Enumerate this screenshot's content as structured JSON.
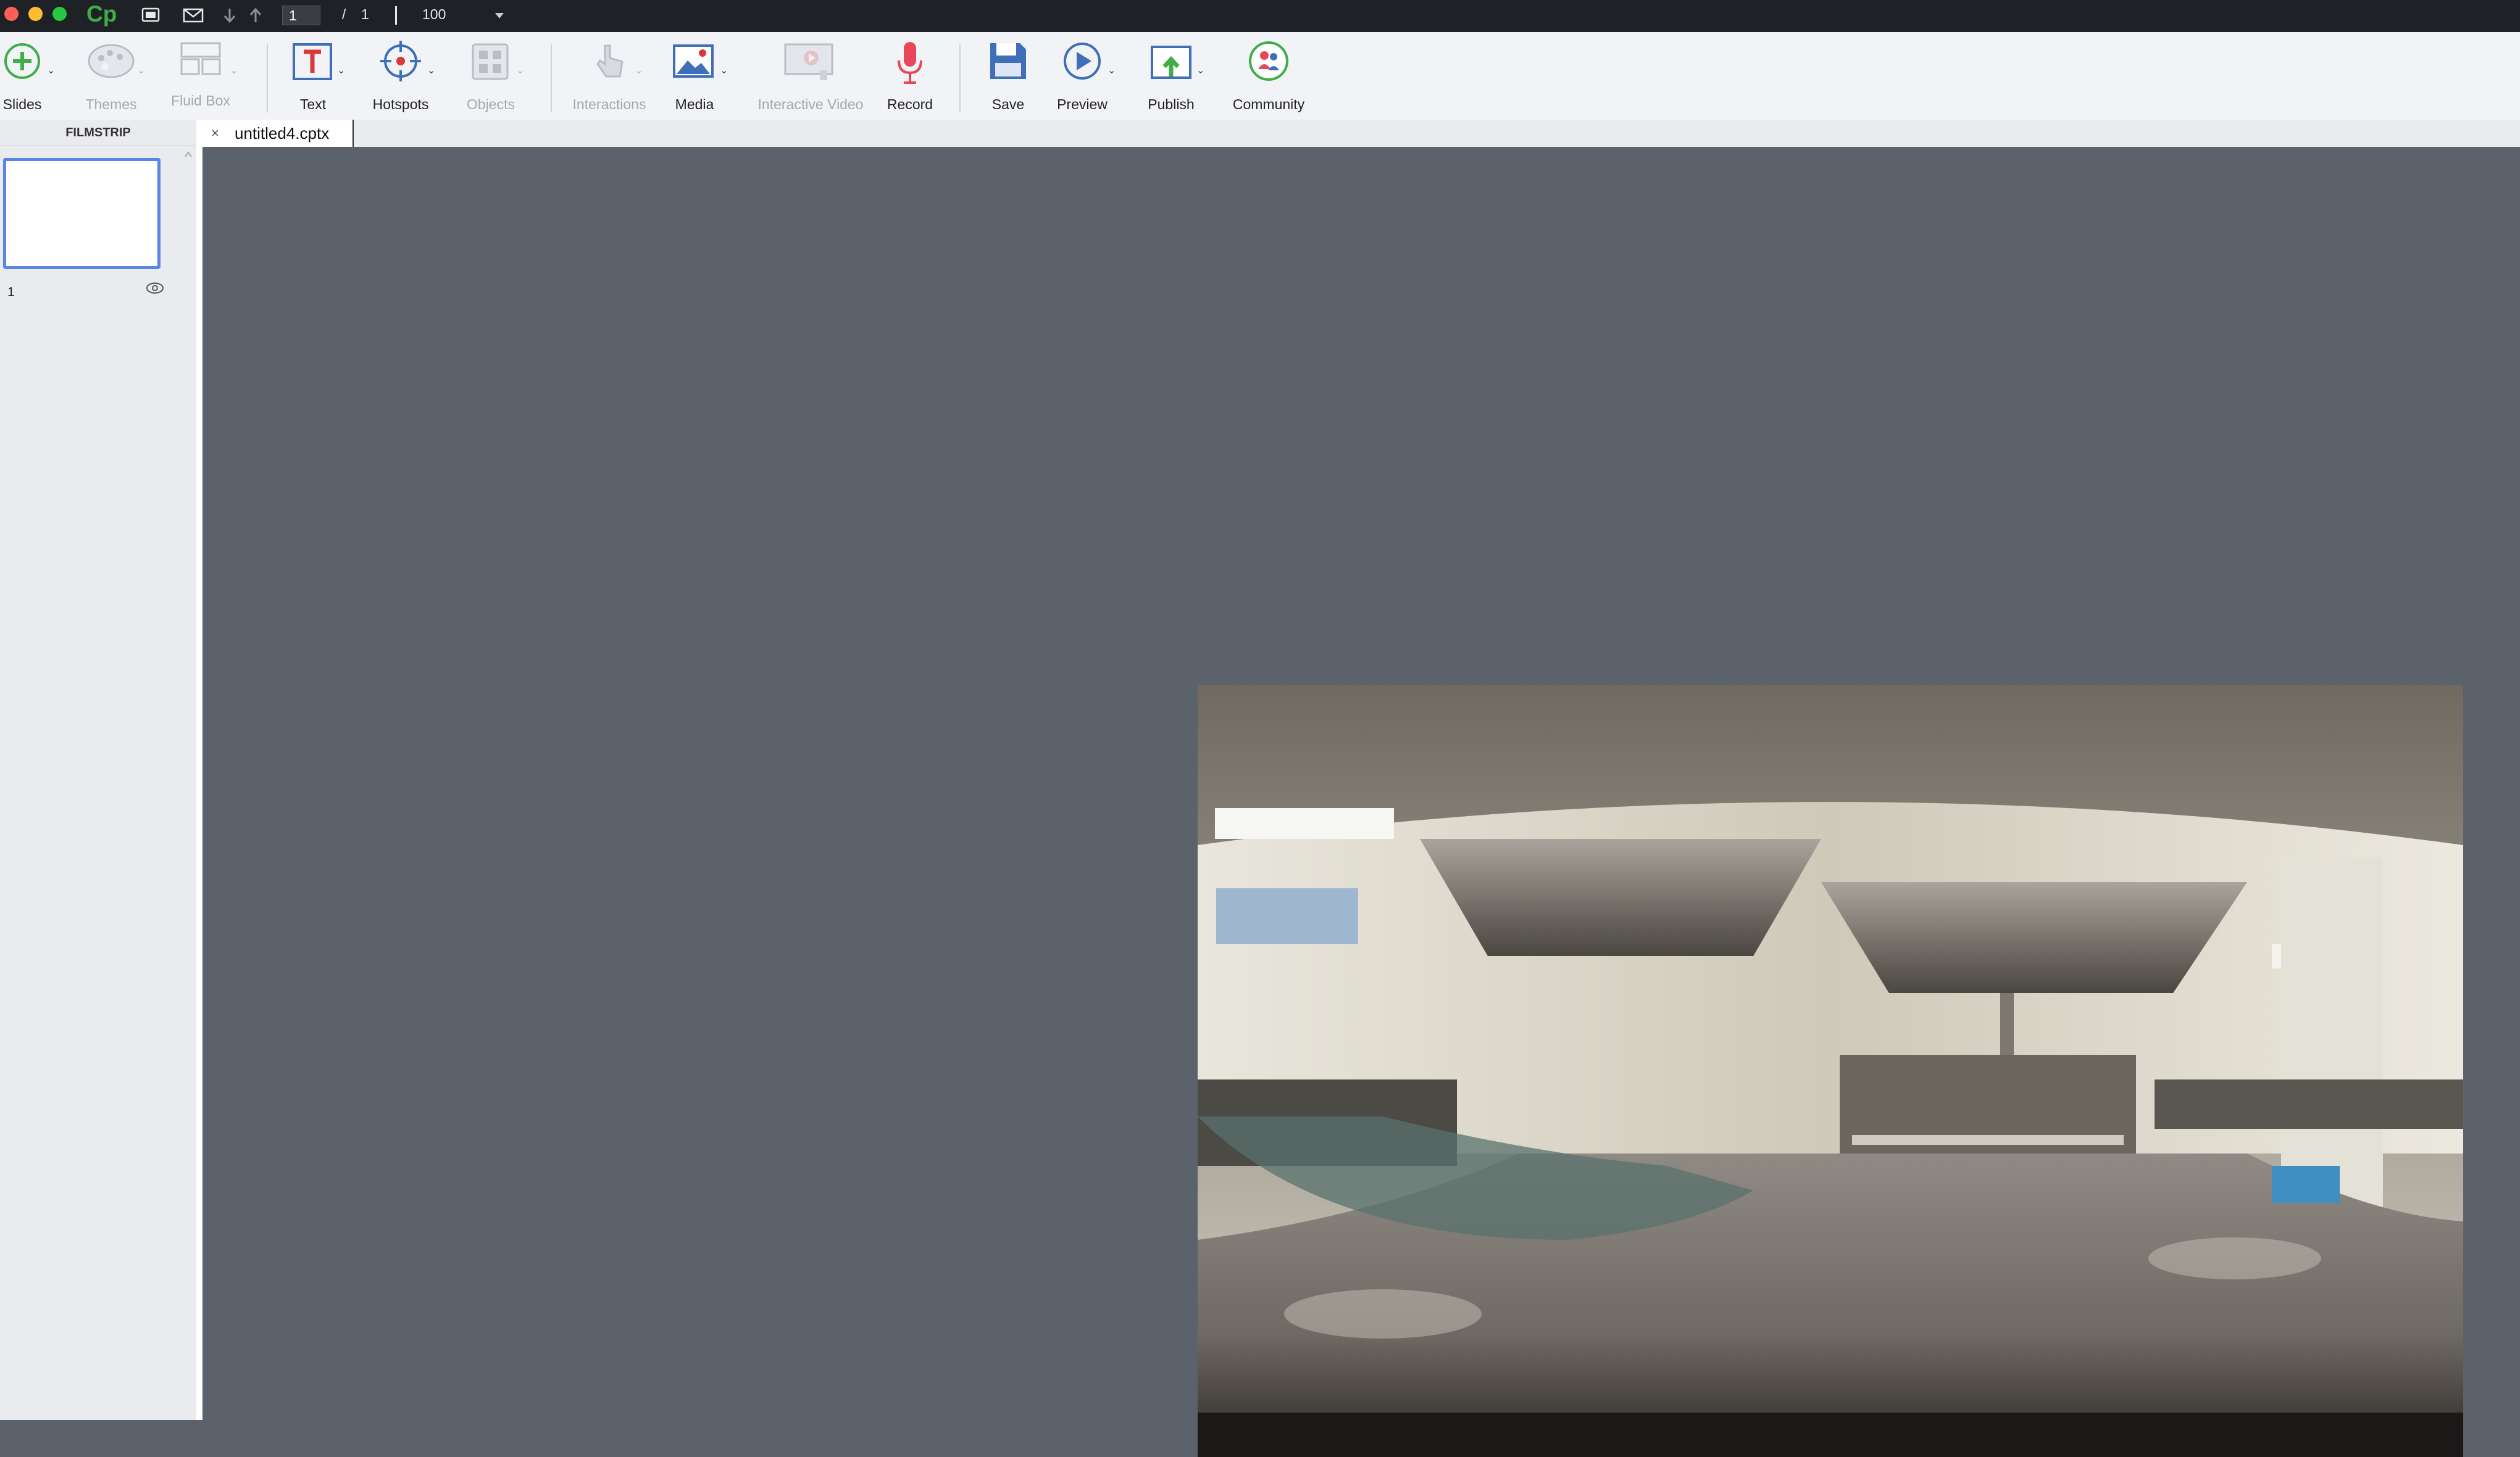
{
  "titlebar": {
    "app_logo": "Cp",
    "page_current": "1",
    "page_separator": "/",
    "page_total": "1",
    "zoom": "100"
  },
  "toolbar": {
    "slides": "Slides",
    "themes": "Themes",
    "fluid_box": "Fluid Box",
    "text": "Text",
    "hotspots": "Hotspots",
    "objects": "Objects",
    "interactions": "Interactions",
    "media": "Media",
    "interactive_video": "Interactive Video",
    "record": "Record",
    "save": "Save",
    "preview": "Preview",
    "publish": "Publish",
    "community": "Community"
  },
  "filmstrip": {
    "header": "FILMSTRIP",
    "slides": [
      {
        "number": "1"
      }
    ]
  },
  "tabs": [
    {
      "close": "×",
      "name": "untitled4.cptx"
    }
  ],
  "colors": {
    "stage_bg": "#5b626c",
    "titlebar_bg": "#1e2126",
    "thumb_border": "#5a84e6",
    "record_red": "#e8465a",
    "brand_green": "#3fae49"
  },
  "icons": {
    "slides": "add-slide-icon",
    "themes": "palette-icon",
    "fluid_box": "fluid-box-icon",
    "text": "text-box-icon",
    "hotspots": "crosshair-icon",
    "objects": "objects-grid-icon",
    "interactions": "hand-pointer-icon",
    "media": "image-icon",
    "interactive_video": "video-icon",
    "record": "microphone-icon",
    "save": "floppy-disk-icon",
    "preview": "play-icon",
    "publish": "upload-icon",
    "community": "people-icon"
  }
}
